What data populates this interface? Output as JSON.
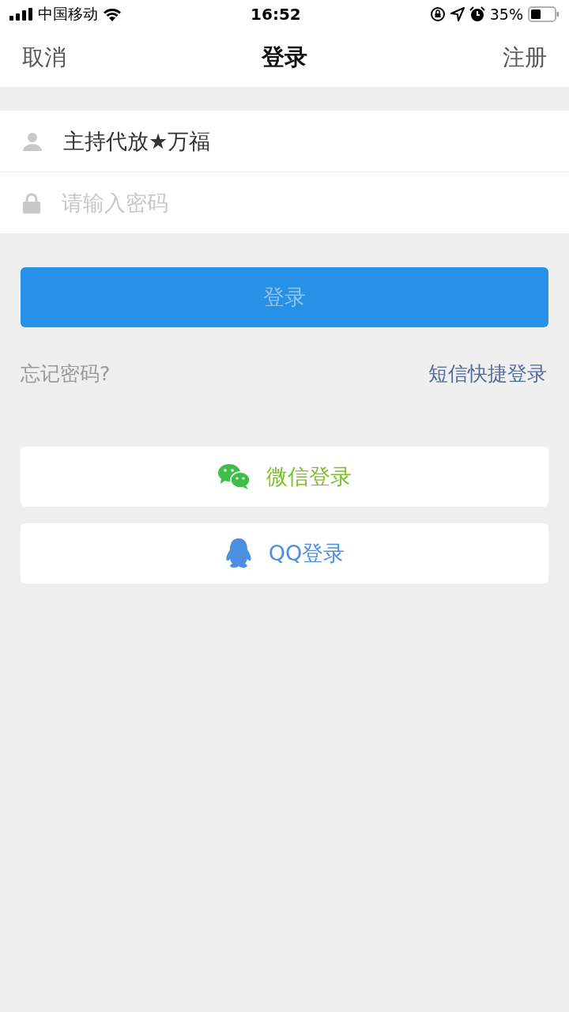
{
  "status_bar": {
    "carrier": "中国移动",
    "time": "16:52",
    "battery": "35%"
  },
  "nav": {
    "left": "取消",
    "title": "登录",
    "right": "注册"
  },
  "form": {
    "username": {
      "value": "主持代放★万福"
    },
    "password": {
      "placeholder": "请输入密码"
    }
  },
  "login_button": {
    "label": "登录",
    "disabled": true
  },
  "links": {
    "forgot": "忘记密码?",
    "sms": "短信快捷登录"
  },
  "social_buttons": [
    {
      "kind": "wechat",
      "label": "微信登录"
    },
    {
      "kind": "qq",
      "label": "QQ登录"
    }
  ]
}
